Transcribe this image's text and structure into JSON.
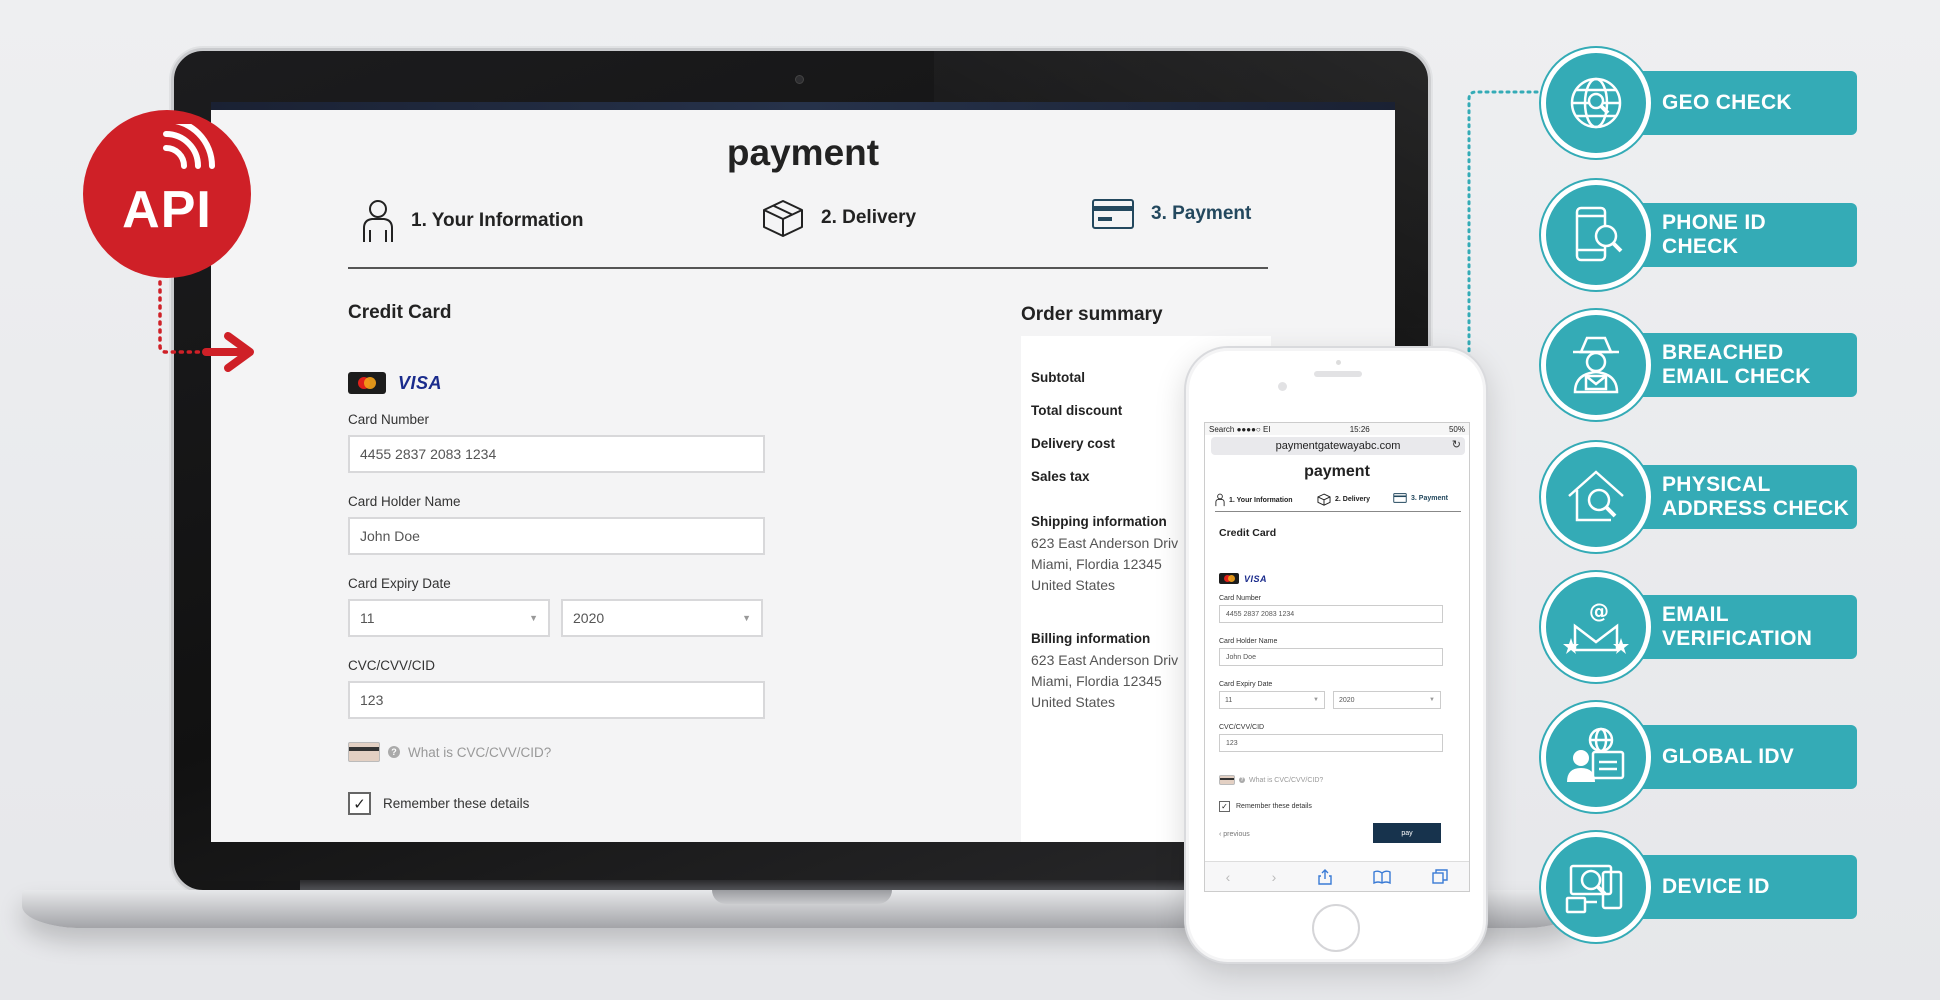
{
  "desktop": {
    "title": "payment",
    "steps": [
      "1. Your Information",
      "2. Delivery",
      "3. Payment"
    ],
    "credit_card_heading": "Credit Card",
    "card_brands": {
      "visa": "VISA"
    },
    "card_number": {
      "label": "Card Number",
      "value": "4455 2837 2083 1234"
    },
    "card_holder": {
      "label": "Card Holder Name",
      "value": "John Doe"
    },
    "expiry": {
      "label": "Card Expiry Date",
      "month": "11",
      "year": "2020"
    },
    "cvc": {
      "label": "CVC/CVV/CID",
      "value": "123"
    },
    "cvc_help": "What is CVC/CVV/CID?",
    "remember": "Remember these details",
    "order_summary": {
      "heading": "Order summary",
      "rows": [
        "Subtotal",
        "Total discount",
        "Delivery cost",
        "Sales tax"
      ],
      "shipping": {
        "heading": "Shipping information",
        "lines": [
          "623 East Anderson Driv",
          "Miami, Flordia 12345",
          "United States"
        ]
      },
      "billing": {
        "heading": "Billing information",
        "lines": [
          "623 East Anderson Driv",
          "Miami, Flordia 12345",
          "United States"
        ]
      }
    }
  },
  "mobile": {
    "status": {
      "left": "Search ●●●●○ EI",
      "time": "15:26",
      "right": "50%"
    },
    "url": "paymentgatewayabc.com",
    "title": "payment",
    "steps": [
      "1. Your Information",
      "2. Delivery",
      "3. Payment"
    ],
    "credit_card_heading": "Credit Card",
    "card_number": {
      "label": "Card Number",
      "value": "4455 2837 2083 1234"
    },
    "card_holder": {
      "label": "Card Holder Name",
      "value": "John Doe"
    },
    "expiry": {
      "label": "Card Expiry Date",
      "month": "11",
      "year": "2020"
    },
    "cvc": {
      "label": "CVC/CVV/CID",
      "value": "123"
    },
    "cvc_help": "What is CVC/CVV/CID?",
    "remember": "Remember these details",
    "previous": "‹ previous",
    "pay": "pay",
    "toolbar_icons": [
      "back-icon",
      "forward-icon",
      "share-icon",
      "bookmarks-icon",
      "tabs-icon"
    ]
  },
  "api_badge": {
    "label": "API",
    "color": "#cf2027"
  },
  "checks": [
    {
      "label": "GEO CHECK",
      "icon": "globe-search-icon"
    },
    {
      "label": "PHONE ID CHECK",
      "icon": "phone-search-icon"
    },
    {
      "label": "BREACHED EMAIL CHECK",
      "icon": "spy-email-icon"
    },
    {
      "label": "PHYSICAL ADDRESS CHECK",
      "icon": "house-search-icon"
    },
    {
      "label": "EMAIL VERIFICATION",
      "icon": "email-stars-icon"
    },
    {
      "label": "GLOBAL IDV",
      "icon": "id-card-globe-icon"
    },
    {
      "label": "DEVICE ID",
      "icon": "devices-search-icon"
    }
  ],
  "colors": {
    "teal": "#34abb6",
    "api_red": "#cf2027",
    "pay_button": "#17334d",
    "step_active": "#23485e"
  }
}
